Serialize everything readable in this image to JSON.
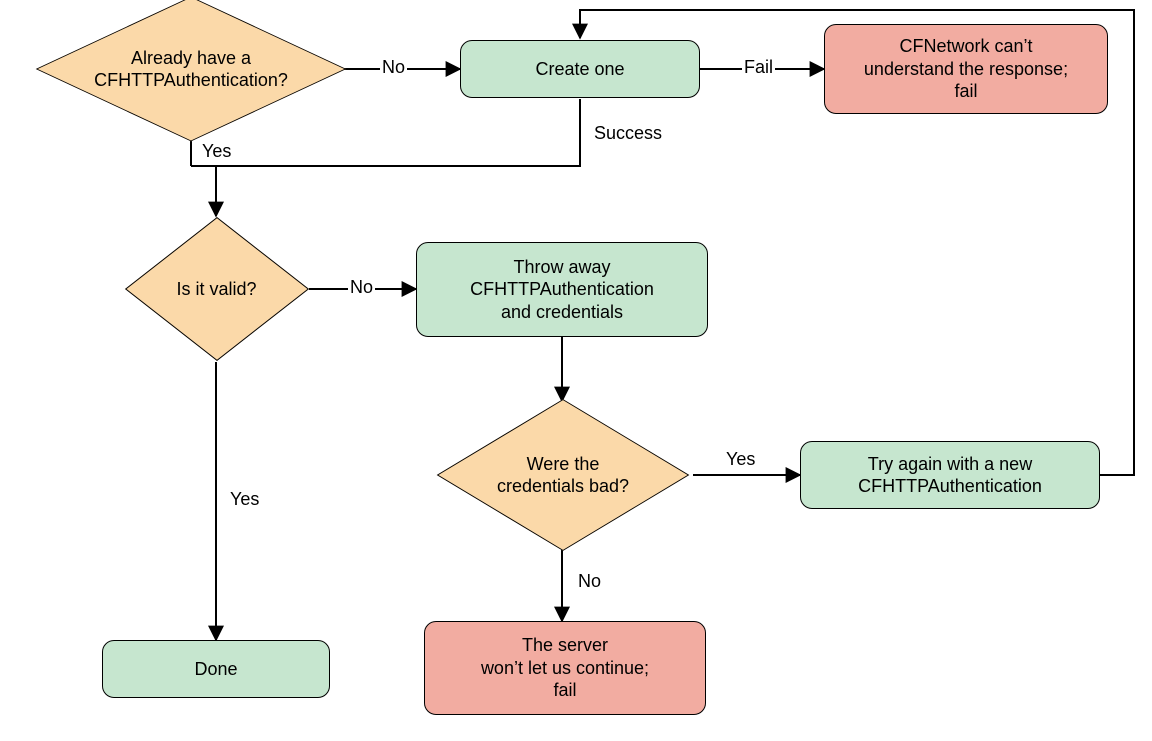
{
  "nodes": {
    "decision_have_auth": "Already have a\nCFHTTPAuthentication?",
    "create_one": "Create one",
    "fail_understand": "CFNetwork can’t\nunderstand the response;\nfail",
    "decision_valid": "Is it valid?",
    "throw_away": "Throw away\nCFHTTPAuthentication\nand credentials",
    "decision_creds_bad": "Were the\ncredentials bad?",
    "try_again": "Try again with a new\nCFHTTPAuthentication",
    "server_fail": "The server\nwon’t let us continue;\nfail",
    "done": "Done"
  },
  "edges": {
    "have_auth_no": "No",
    "have_auth_yes": "Yes",
    "create_success": "Success",
    "create_fail": "Fail",
    "valid_no": "No",
    "valid_yes": "Yes",
    "creds_yes": "Yes",
    "creds_no": "No"
  },
  "colors": {
    "decision": "#fbd9a9",
    "process": "#c6e6cf",
    "terminal_fail": "#f2aca1"
  }
}
